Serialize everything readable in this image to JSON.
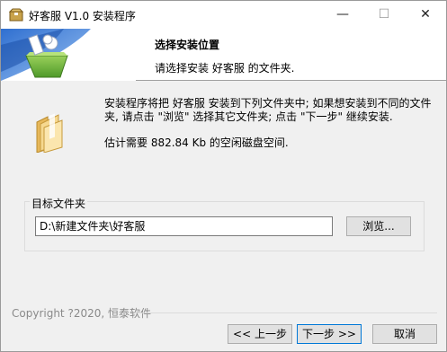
{
  "window": {
    "title": "好客服 V1.0 安装程序",
    "minimize_glyph": "—",
    "maximize_glyph": "☐",
    "close_glyph": "✕"
  },
  "header": {
    "title": "选择安装位置",
    "subtitle": "请选择安装 好客服 的文件夹."
  },
  "body": {
    "intro": "安装程序将把 好客服 安装到下列文件夹中; 如果想安装到不同的文件夹, 请点击 \"浏览\" 选择其它文件夹; 点击 \"下一步\" 继续安装.",
    "space_required": "估计需要 882.84 Kb 的空闲磁盘空间."
  },
  "destination": {
    "group_label": "目标文件夹",
    "path_value": "D:\\新建文件夹\\好客服",
    "browse_label": "浏览..."
  },
  "footer": {
    "copyright": "Copyright ?2020, 恒泰软件",
    "back_label": "<< 上一步",
    "next_label": "下一步 >>",
    "cancel_label": "取消"
  },
  "icons": {
    "app": "installer-box-icon",
    "header": "installer-banner-graphic",
    "folder": "folder-icon"
  }
}
